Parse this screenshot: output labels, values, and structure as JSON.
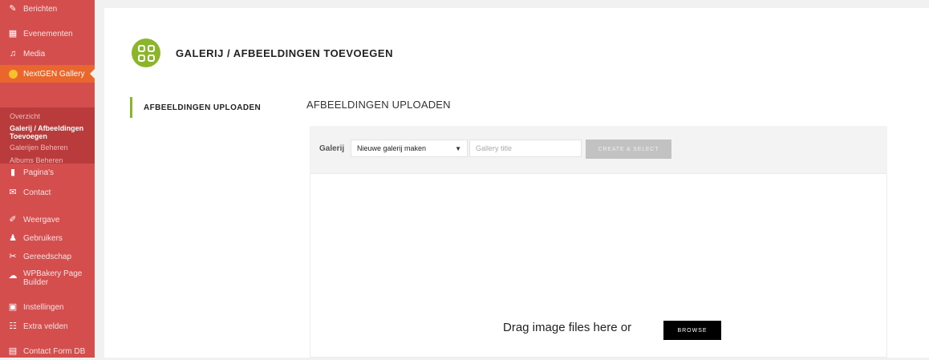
{
  "sidebar": {
    "items": [
      {
        "label": "Berichten",
        "icon": "pin-icon",
        "glyph": "✎"
      },
      {
        "label": "Evenementen",
        "icon": "calendar-icon",
        "glyph": "▦"
      },
      {
        "label": "Media",
        "icon": "media-icon",
        "glyph": "♫"
      },
      {
        "label": "NextGEN Gallery",
        "icon": "nextgen-icon",
        "glyph": ""
      },
      {
        "label": "Pagina's",
        "icon": "page-icon",
        "glyph": "▮"
      },
      {
        "label": "Contact",
        "icon": "envelope-icon",
        "glyph": "✉"
      },
      {
        "label": "Weergave",
        "icon": "paintbrush-icon",
        "glyph": "✐"
      },
      {
        "label": "Gebruikers",
        "icon": "users-icon",
        "glyph": "♟"
      },
      {
        "label": "Gereedschap",
        "icon": "wrench-icon",
        "glyph": "✂"
      },
      {
        "label": "WPBakery Page Builder",
        "icon": "wpbakery-icon",
        "glyph": "☁"
      },
      {
        "label": "Instellingen",
        "icon": "settings-icon",
        "glyph": "▣"
      },
      {
        "label": "Extra velden",
        "icon": "fields-icon",
        "glyph": "☷"
      },
      {
        "label": "Contact Form DB",
        "icon": "database-icon",
        "glyph": "▤"
      }
    ],
    "submenu": [
      {
        "label": "Overzicht"
      },
      {
        "label": "Galerij / Afbeeldingen Toevoegen"
      },
      {
        "label": "Galerijen Beheren"
      },
      {
        "label": "Albums Beheren"
      }
    ]
  },
  "header": {
    "title": "GALERIJ / AFBEELDINGEN TOEVOEGEN",
    "icon": "gallery-grid-icon"
  },
  "tabs": {
    "upload_label": "AFBEELDINGEN UPLOADEN"
  },
  "upload": {
    "section_title": "AFBEELDINGEN UPLOADEN",
    "gallery_label": "Galerij",
    "select_value": "Nieuwe galerij maken",
    "title_placeholder": "Gallery title",
    "create_button": "CREATE & SELECT",
    "drop_text": "Drag image files here or",
    "browse_button": "BROWSE"
  },
  "colors": {
    "sidebar_bg": "#d54e4e",
    "active_item": "#e9662c",
    "accent_green": "#8bb62b"
  }
}
